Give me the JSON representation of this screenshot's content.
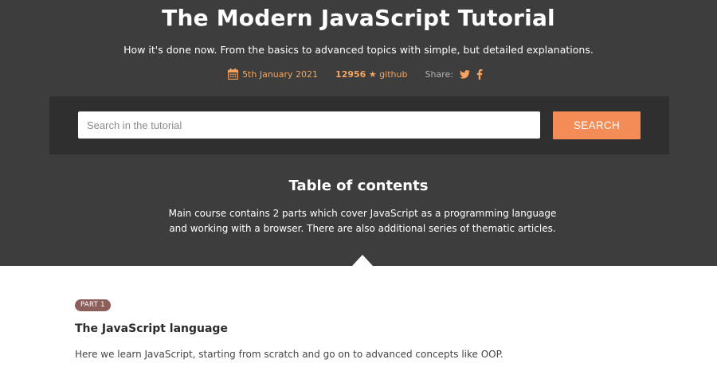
{
  "header": {
    "title": "The Modern JavaScript Tutorial",
    "subtitle": "How it's done now. From the basics to advanced topics with simple, but detailed explanations."
  },
  "meta": {
    "date": "5th January 2021",
    "date_icon": "calendar-icon",
    "github_count": "12956",
    "github_label": "★ github",
    "share_label": "Share:",
    "share_icons": [
      "twitter-icon",
      "facebook-icon"
    ]
  },
  "search": {
    "placeholder": "Search in the tutorial",
    "value": "",
    "button_label": "SEARCH"
  },
  "toc": {
    "title": "Table of contents",
    "description": "Main course contains 2 parts which cover JavaScript as a programming language and working with a browser. There are also additional series of thematic articles."
  },
  "parts": [
    {
      "badge": "PART 1",
      "title": "The JavaScript language",
      "description": "Here we learn JavaScript, starting from scratch and go on to advanced concepts like OOP."
    }
  ],
  "colors": {
    "hero_bg": "#3d3d3d",
    "search_band_bg": "#2f2f2f",
    "accent": "#f38c56",
    "meta_text": "#f5a35f",
    "badge_bg": "#8d5e5a"
  }
}
